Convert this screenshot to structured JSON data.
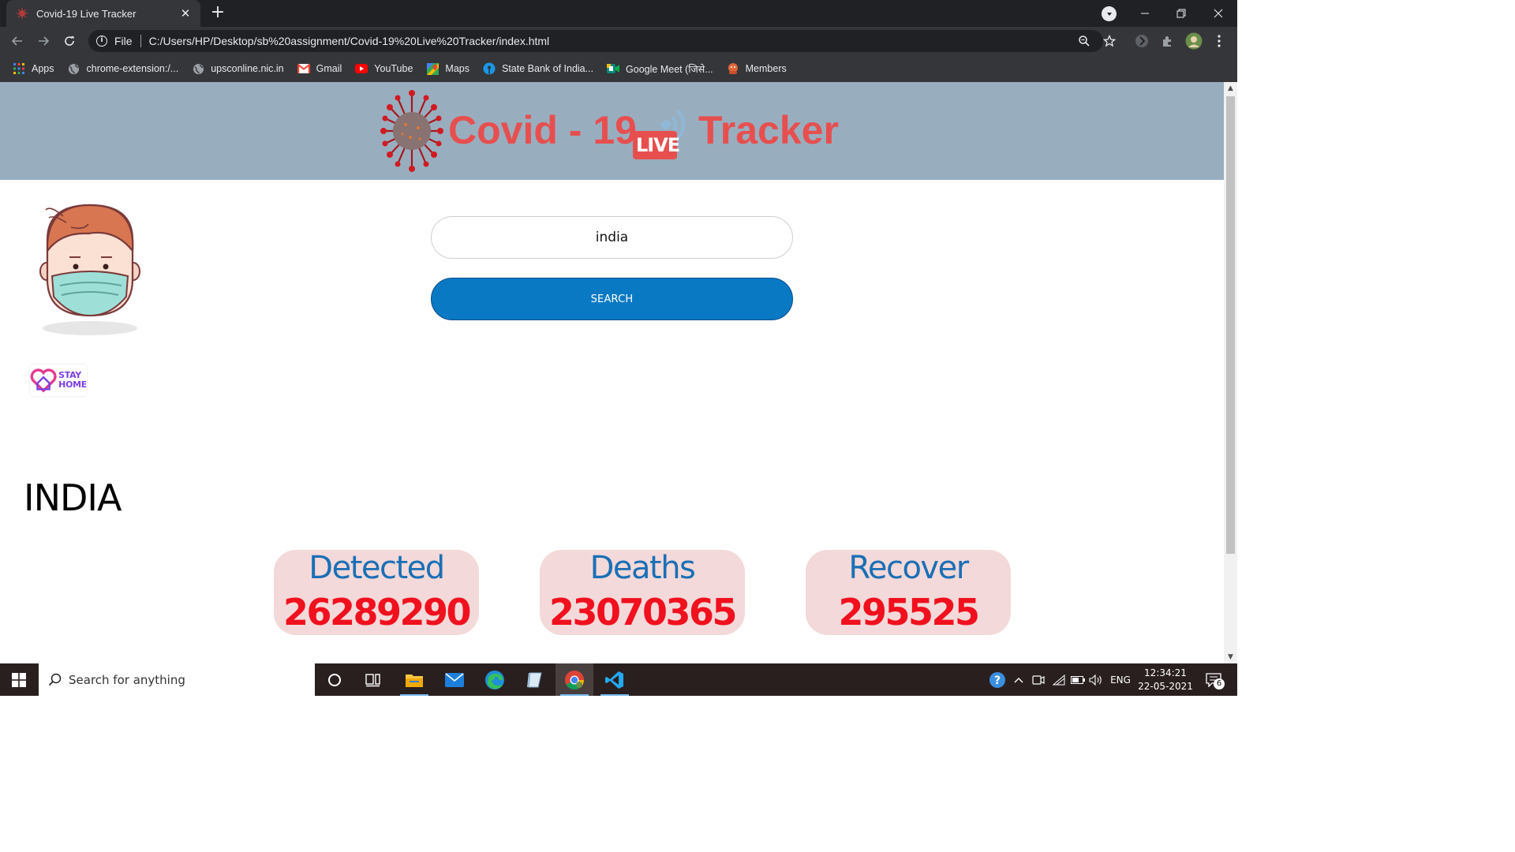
{
  "browser": {
    "tab_title": "Covid-19 Live Tracker",
    "file_label": "File",
    "url": "C:/Users/HP/Desktop/sb%20assignment/Covid-19%20Live%20Tracker/index.html",
    "bookmarks": [
      {
        "label": "Apps",
        "icon": "apps-grid-icon"
      },
      {
        "label": "chrome-extension:/...",
        "icon": "globe-icon"
      },
      {
        "label": "upsconline.nic.in",
        "icon": "globe-icon"
      },
      {
        "label": "Gmail",
        "icon": "gmail-icon"
      },
      {
        "label": "YouTube",
        "icon": "youtube-icon"
      },
      {
        "label": "Maps",
        "icon": "maps-icon"
      },
      {
        "label": "State Bank of India...",
        "icon": "sbi-icon"
      },
      {
        "label": "Google Meet (जिसे...",
        "icon": "meet-icon"
      },
      {
        "label": "Members",
        "icon": "members-icon"
      }
    ]
  },
  "page": {
    "logo": {
      "part1": "Covid - 19",
      "badge": "LIVE",
      "part2": "Tracker"
    },
    "stay_home": {
      "line1": "STAY",
      "line2": "HOME"
    },
    "search": {
      "value": "india",
      "button_label": "SEARCH"
    },
    "country": "INDIA",
    "stats": [
      {
        "label": "Detected",
        "value": "26289290"
      },
      {
        "label": "Deaths",
        "value": "23070365"
      },
      {
        "label": "Recover",
        "value": "295525"
      }
    ]
  },
  "taskbar": {
    "search_placeholder": "Search for anything",
    "language": "ENG",
    "time": "12:34:21",
    "date": "22-05-2021",
    "notification_count": "6"
  },
  "colors": {
    "header_bg": "#98aebf",
    "logo_red": "#e74f4f",
    "button_blue": "#0a79c4",
    "card_bg": "#f3d9d9",
    "card_label": "#1a6fb6",
    "card_value": "#f0101e"
  }
}
